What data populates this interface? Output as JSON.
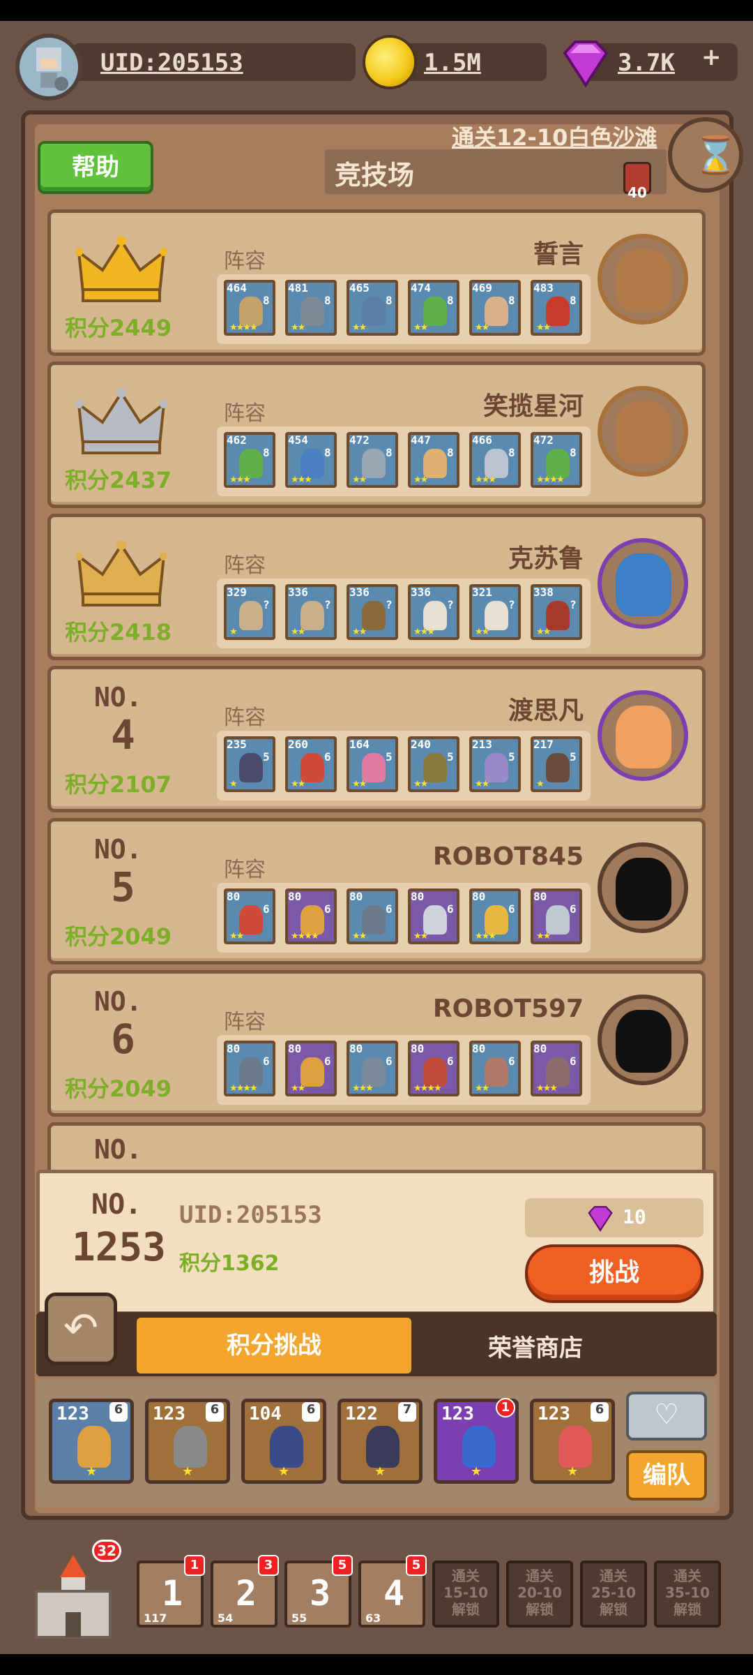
{
  "header": {
    "uid": "UID:205153",
    "coins": "1.5M",
    "gems": "3.7K",
    "plus": "+"
  },
  "arena": {
    "help_label": "帮助",
    "title": "竞技场",
    "unlock_text": "通关12-10白色沙滩",
    "tickets": "40"
  },
  "lineup_label": "阵容",
  "ranking": [
    {
      "rank_no": "",
      "rank": "",
      "crown": "gold",
      "score": "积分2449",
      "name": "誓言",
      "opp_color": "#b07a4a",
      "ring": "#a8703a",
      "units": [
        {
          "lv": "464",
          "s": "8",
          "stars": "★★★★",
          "c": "#c5a26a"
        },
        {
          "lv": "481",
          "s": "8",
          "stars": "★★",
          "c": "#7e8a97"
        },
        {
          "lv": "465",
          "s": "8",
          "stars": "★★",
          "c": "#5b7fa8"
        },
        {
          "lv": "474",
          "s": "8",
          "stars": "★★",
          "c": "#62b04a"
        },
        {
          "lv": "469",
          "s": "8",
          "stars": "★★",
          "c": "#d9b28c"
        },
        {
          "lv": "483",
          "s": "8",
          "stars": "★★",
          "c": "#c83a2a"
        }
      ]
    },
    {
      "rank_no": "",
      "rank": "",
      "crown": "silver",
      "score": "积分2437",
      "name": "笑揽星河",
      "opp_color": "#b07a4a",
      "ring": "#a8703a",
      "units": [
        {
          "lv": "462",
          "s": "8",
          "stars": "★★★",
          "c": "#62b04a"
        },
        {
          "lv": "454",
          "s": "8",
          "stars": "★★★",
          "c": "#4a7fc2"
        },
        {
          "lv": "472",
          "s": "8",
          "stars": "★★",
          "c": "#9aa6b2"
        },
        {
          "lv": "447",
          "s": "8",
          "stars": "★★",
          "c": "#e0b070"
        },
        {
          "lv": "466",
          "s": "8",
          "stars": "★★★",
          "c": "#b9c4d0"
        },
        {
          "lv": "472",
          "s": "8",
          "stars": "★★★★",
          "c": "#62b04a"
        }
      ]
    },
    {
      "rank_no": "",
      "rank": "",
      "crown": "bronze",
      "score": "积分2418",
      "name": "克苏鲁",
      "opp_color": "#3a7fc8",
      "ring": "#7b3fb0",
      "units": [
        {
          "lv": "329",
          "s": "?",
          "stars": "★",
          "c": "#c8b08a"
        },
        {
          "lv": "336",
          "s": "?",
          "stars": "★★",
          "c": "#c8b08a"
        },
        {
          "lv": "336",
          "s": "?",
          "stars": "★★",
          "c": "#8a6a3a"
        },
        {
          "lv": "336",
          "s": "?",
          "stars": "★★★",
          "c": "#e8e0d0"
        },
        {
          "lv": "321",
          "s": "?",
          "stars": "★★",
          "c": "#e8e0d0"
        },
        {
          "lv": "338",
          "s": "?",
          "stars": "★★",
          "c": "#a83a2a"
        }
      ]
    },
    {
      "rank_no": "NO.",
      "rank": "4",
      "crown": "",
      "score": "积分2107",
      "name": "渡思凡",
      "opp_color": "#f0a060",
      "ring": "#7b3fb0",
      "units": [
        {
          "lv": "235",
          "s": "5",
          "stars": "★",
          "c": "#4a4a6a"
        },
        {
          "lv": "260",
          "s": "6",
          "stars": "★★",
          "c": "#d04a3a"
        },
        {
          "lv": "164",
          "s": "5",
          "stars": "★★",
          "c": "#e07aa0"
        },
        {
          "lv": "240",
          "s": "5",
          "stars": "★★",
          "c": "#8a7a3a"
        },
        {
          "lv": "213",
          "s": "5",
          "stars": "★★",
          "c": "#9a8ac8"
        },
        {
          "lv": "217",
          "s": "5",
          "stars": "★",
          "c": "#6a4a3a"
        }
      ]
    },
    {
      "rank_no": "NO.",
      "rank": "5",
      "crown": "",
      "score": "积分2049",
      "name": "ROBOT845",
      "opp_color": "#111111",
      "ring": "#5b3f2e",
      "units": [
        {
          "lv": "80",
          "s": "6",
          "stars": "★★",
          "c": "#d04a3a"
        },
        {
          "lv": "80",
          "s": "6",
          "stars": "★★★★",
          "c": "#e0a040"
        },
        {
          "lv": "80",
          "s": "6",
          "stars": "★★",
          "c": "#6a7a8a"
        },
        {
          "lv": "80",
          "s": "6",
          "stars": "★★",
          "c": "#d0d4da"
        },
        {
          "lv": "80",
          "s": "6",
          "stars": "★★★",
          "c": "#e8b840"
        },
        {
          "lv": "80",
          "s": "6",
          "stars": "★★",
          "c": "#c0c8d0"
        }
      ]
    },
    {
      "rank_no": "NO.",
      "rank": "6",
      "crown": "",
      "score": "积分2049",
      "name": "ROBOT597",
      "opp_color": "#111111",
      "ring": "#5b3f2e",
      "units": [
        {
          "lv": "80",
          "s": "6",
          "stars": "★★★★",
          "c": "#6a7a8a"
        },
        {
          "lv": "80",
          "s": "6",
          "stars": "★★",
          "c": "#e0a040"
        },
        {
          "lv": "80",
          "s": "6",
          "stars": "★★★",
          "c": "#7a8a9a"
        },
        {
          "lv": "80",
          "s": "6",
          "stars": "★★★★",
          "c": "#c04a3a"
        },
        {
          "lv": "80",
          "s": "6",
          "stars": "★★",
          "c": "#b07a6a"
        },
        {
          "lv": "80",
          "s": "6",
          "stars": "★★★",
          "c": "#8a6a6a"
        }
      ]
    },
    {
      "rank_no": "NO.",
      "rank": "",
      "crown": "",
      "score": "",
      "name": "",
      "opp_color": "",
      "ring": "",
      "units": []
    }
  ],
  "me": {
    "rank_no": "NO.",
    "rank": "1253",
    "uid": "UID:205153",
    "score": "积分1362",
    "cost": "10",
    "challenge_label": "挑战"
  },
  "tabs": {
    "active": "积分挑战",
    "shop": "荣誉商店"
  },
  "my_team": [
    {
      "lv": "123",
      "b": "6",
      "red": "",
      "c": "#e0a040",
      "frame": "#5a7fa8"
    },
    {
      "lv": "123",
      "b": "6",
      "red": "",
      "c": "#8a8a8a",
      "frame": "#a0703a"
    },
    {
      "lv": "104",
      "b": "6",
      "red": "",
      "c": "#3a4a8a",
      "frame": "#a0703a"
    },
    {
      "lv": "122",
      "b": "7",
      "red": "",
      "c": "#3a3a5a",
      "frame": "#a0703a"
    },
    {
      "lv": "123",
      "b": "",
      "red": "1",
      "c": "#3a6ad0",
      "frame": "#7b3fb0"
    },
    {
      "lv": "123",
      "b": "6",
      "red": "",
      "c": "#e05a5a",
      "frame": "#a0703a"
    }
  ],
  "team_button": "编队",
  "castle_badge": "32",
  "stages": [
    {
      "n": "1",
      "r": "1",
      "c": "117"
    },
    {
      "n": "2",
      "r": "3",
      "c": "54"
    },
    {
      "n": "3",
      "r": "5",
      "c": "55"
    },
    {
      "n": "4",
      "r": "5",
      "c": "63"
    }
  ],
  "locked_stages": [
    {
      "l1": "通关",
      "l2": "15-10",
      "l3": "解锁"
    },
    {
      "l1": "通关",
      "l2": "20-10",
      "l3": "解锁"
    },
    {
      "l1": "通关",
      "l2": "25-10",
      "l3": "解锁"
    },
    {
      "l1": "通关",
      "l2": "35-10",
      "l3": "解锁"
    }
  ],
  "colors": {
    "gold_crown": "#f2b623",
    "silver_crown": "#b8bcc2",
    "bronze_crown": "#e0b050",
    "score_green": "#7cae28",
    "challenge": "#f05f23",
    "accent_tab": "#f3a52e"
  }
}
